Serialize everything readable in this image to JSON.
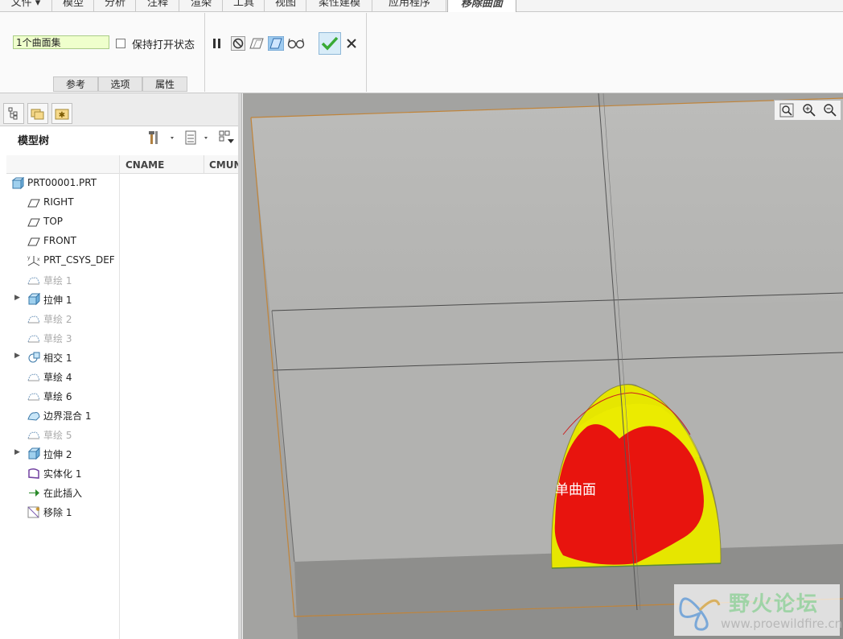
{
  "menu": {
    "tabs": [
      "文件 ▾",
      "模型",
      "分析",
      "注释",
      "渲染",
      "工具",
      "视图",
      "柔性建模",
      "应用程序",
      "移除曲面"
    ]
  },
  "ribbon": {
    "selection_field": "1个曲面集",
    "keep_open_label": "保持打开状态",
    "subtabs": [
      "参考",
      "选项",
      "属性"
    ],
    "ok_color": "#3aaa35"
  },
  "panel": {
    "title": "模型树",
    "columns": [
      "CNAME",
      "CMUN"
    ],
    "tree": [
      {
        "label": "PRT00001.PRT",
        "icon": "part-icon",
        "dim": false,
        "expand": false
      },
      {
        "label": "RIGHT",
        "icon": "datum-plane-icon",
        "dim": false,
        "expand": false
      },
      {
        "label": "TOP",
        "icon": "datum-plane-icon",
        "dim": false,
        "expand": false
      },
      {
        "label": "FRONT",
        "icon": "datum-plane-icon",
        "dim": false,
        "expand": false
      },
      {
        "label": "PRT_CSYS_DEF",
        "icon": "csys-icon",
        "dim": false,
        "expand": false
      },
      {
        "label": "草绘 1",
        "icon": "sketch-icon",
        "dim": true,
        "expand": false
      },
      {
        "label": "拉伸 1",
        "icon": "extrude-icon",
        "dim": false,
        "expand": true
      },
      {
        "label": "草绘 2",
        "icon": "sketch-icon",
        "dim": true,
        "expand": false
      },
      {
        "label": "草绘 3",
        "icon": "sketch-icon",
        "dim": true,
        "expand": false
      },
      {
        "label": "相交 1",
        "icon": "intersect-icon",
        "dim": false,
        "expand": true
      },
      {
        "label": "草绘 4",
        "icon": "sketch-icon",
        "dim": false,
        "expand": false
      },
      {
        "label": "草绘 6",
        "icon": "sketch-icon",
        "dim": false,
        "expand": false
      },
      {
        "label": "边界混合 1",
        "icon": "boundary-blend-icon",
        "dim": false,
        "expand": false
      },
      {
        "label": "草绘 5",
        "icon": "sketch-icon",
        "dim": true,
        "expand": false
      },
      {
        "label": "拉伸 2",
        "icon": "extrude-icon",
        "dim": false,
        "expand": true
      },
      {
        "label": "实体化 1",
        "icon": "solidify-icon",
        "dim": false,
        "expand": false
      },
      {
        "label": "在此插入",
        "icon": "insert-here-icon",
        "dim": false,
        "expand": false
      },
      {
        "label": "移除 1",
        "icon": "remove-icon",
        "dim": false,
        "expand": false
      }
    ]
  },
  "viewport": {
    "surface_label": "单曲面",
    "watermark_cn": "野火论坛",
    "watermark_url": "www.proewildfire.cn",
    "colors": {
      "background": "#9c9c99",
      "surface_red": "#e8140e",
      "surface_yellow": "#e6e600",
      "plane_edge": "#c0843a"
    }
  }
}
